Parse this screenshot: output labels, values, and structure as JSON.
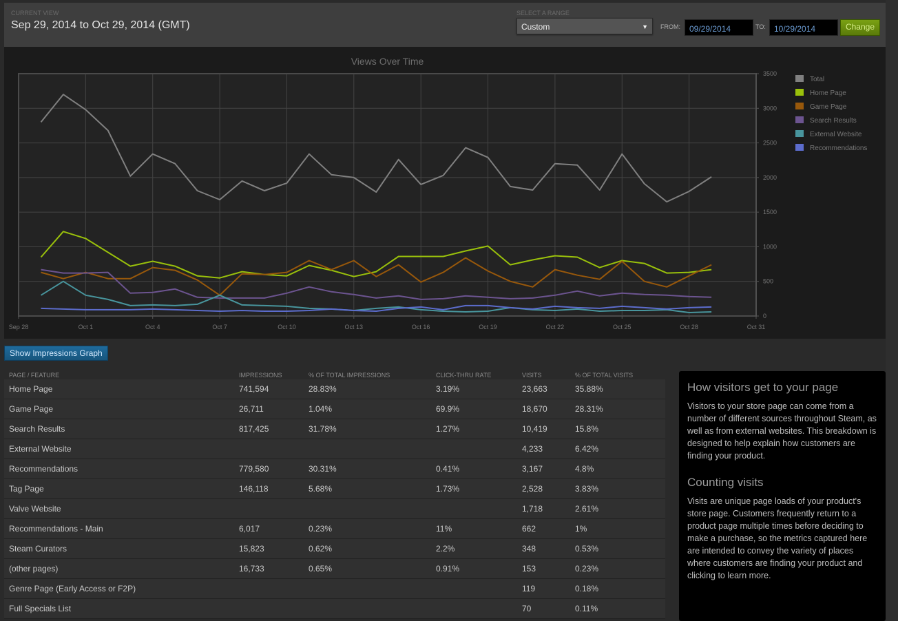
{
  "header": {
    "current_view_label": "CURRENT VIEW",
    "current_view": "Sep 29, 2014 to Oct 29, 2014 (GMT)",
    "range_label": "SELECT A RANGE",
    "range_selected": "Custom",
    "from_label": "FROM:",
    "from_value": "09/29/2014",
    "to_label": "TO:",
    "to_value": "10/29/2014",
    "change_label": "Change"
  },
  "show_impressions_label": "Show Impressions Graph",
  "chart_data": {
    "type": "line",
    "title": "Views Over Time",
    "xlabel": "",
    "ylabel": "",
    "x_start": "2014-09-29",
    "x_ticks": [
      "Sep 28",
      "Oct 1",
      "Oct 4",
      "Oct 7",
      "Oct 10",
      "Oct 13",
      "Oct 16",
      "Oct 19",
      "Oct 22",
      "Oct 25",
      "Oct 28",
      "Oct 31"
    ],
    "y_ticks": [
      0,
      500,
      1000,
      1500,
      2000,
      2500,
      3000,
      3500
    ],
    "ylim": [
      0,
      3500
    ],
    "grid": true,
    "legend_position": "right",
    "series": [
      {
        "name": "Total",
        "color": "#808080",
        "values": [
          2800,
          3200,
          2980,
          2680,
          2020,
          2340,
          2200,
          1810,
          1680,
          1950,
          1810,
          1920,
          2340,
          2040,
          2000,
          1790,
          2260,
          1900,
          2030,
          2430,
          2290,
          1870,
          1820,
          2200,
          2180,
          1820,
          2340,
          1910,
          1650,
          1800,
          2010
        ]
      },
      {
        "name": "Home Page",
        "color": "#9ac10b",
        "values": [
          850,
          1220,
          1120,
          920,
          720,
          790,
          720,
          580,
          550,
          640,
          600,
          580,
          730,
          660,
          570,
          640,
          860,
          860,
          860,
          940,
          1010,
          740,
          810,
          870,
          850,
          700,
          800,
          760,
          620,
          630,
          670
        ]
      },
      {
        "name": "Game Page",
        "color": "#98580b",
        "values": [
          630,
          540,
          630,
          540,
          540,
          700,
          660,
          520,
          300,
          610,
          600,
          630,
          800,
          670,
          800,
          570,
          740,
          490,
          630,
          840,
          650,
          500,
          420,
          670,
          590,
          530,
          790,
          500,
          420,
          580,
          740
        ]
      },
      {
        "name": "Search Results",
        "color": "#6c5490",
        "values": [
          670,
          620,
          620,
          630,
          330,
          340,
          390,
          270,
          260,
          260,
          260,
          330,
          420,
          350,
          310,
          260,
          290,
          240,
          250,
          290,
          270,
          250,
          260,
          300,
          360,
          290,
          330,
          310,
          300,
          280,
          270
        ]
      },
      {
        "name": "External Website",
        "color": "#48959d",
        "values": [
          300,
          500,
          300,
          240,
          150,
          160,
          150,
          170,
          300,
          160,
          150,
          140,
          110,
          100,
          80,
          110,
          130,
          90,
          70,
          60,
          70,
          120,
          90,
          80,
          100,
          70,
          80,
          80,
          90,
          50,
          60
        ]
      },
      {
        "name": "Recommendations",
        "color": "#5c6ccc",
        "values": [
          110,
          100,
          90,
          90,
          90,
          100,
          90,
          80,
          70,
          80,
          70,
          70,
          80,
          100,
          80,
          70,
          110,
          130,
          90,
          150,
          150,
          120,
          100,
          140,
          120,
          110,
          140,
          120,
          100,
          120,
          130
        ]
      }
    ]
  },
  "table": {
    "headers": [
      "PAGE / FEATURE",
      "IMPRESSIONS",
      "% OF TOTAL IMPRESSIONS",
      "CLICK-THRU RATE",
      "VISITS",
      "% OF TOTAL VISITS"
    ],
    "rows": [
      [
        "Home Page",
        "741,594",
        "28.83%",
        "3.19%",
        "23,663",
        "35.88%"
      ],
      [
        "Game Page",
        "26,711",
        "1.04%",
        "69.9%",
        "18,670",
        "28.31%"
      ],
      [
        "Search Results",
        "817,425",
        "31.78%",
        "1.27%",
        "10,419",
        "15.8%"
      ],
      [
        "External Website",
        "",
        "",
        "",
        "4,233",
        "6.42%"
      ],
      [
        "Recommendations",
        "779,580",
        "30.31%",
        "0.41%",
        "3,167",
        "4.8%"
      ],
      [
        "Tag Page",
        "146,118",
        "5.68%",
        "1.73%",
        "2,528",
        "3.83%"
      ],
      [
        "Valve Website",
        "",
        "",
        "",
        "1,718",
        "2.61%"
      ],
      [
        "Recommendations - Main",
        "6,017",
        "0.23%",
        "11%",
        "662",
        "1%"
      ],
      [
        "Steam Curators",
        "15,823",
        "0.62%",
        "2.2%",
        "348",
        "0.53%"
      ],
      [
        "(other pages)",
        "16,733",
        "0.65%",
        "0.91%",
        "153",
        "0.23%"
      ],
      [
        "Genre Page (Early Access or F2P)",
        "",
        "",
        "",
        "119",
        "0.18%"
      ],
      [
        "Full Specials List",
        "",
        "",
        "",
        "70",
        "0.11%"
      ]
    ]
  },
  "side_panel": {
    "h1": "How visitors get to your page",
    "p1": "Visitors to your store page can come from a number of different sources throughout Steam, as well as from external websites. This breakdown is designed to help explain how customers are finding your product.",
    "h2": "Counting visits",
    "p2": "Visits are unique page loads of your product's store page. Customers frequently return to a product page multiple times before deciding to make a purchase, so the metrics captured here are intended to convey the variety of places where customers are finding your product and clicking to learn more."
  }
}
